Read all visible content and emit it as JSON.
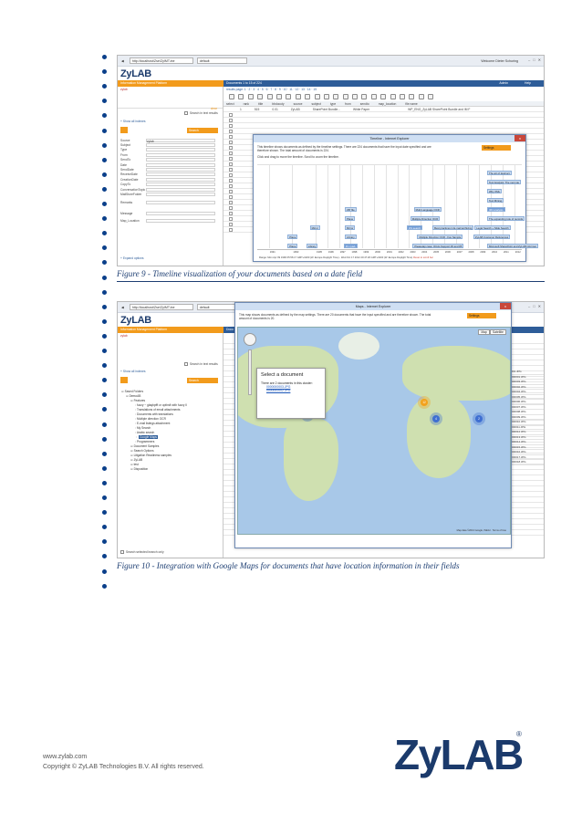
{
  "figure9": {
    "caption": "Figure 9 - Timeline visualization of your documents based on a date field",
    "browser": {
      "url": "http://localhost/Zse/ZyIMT.ine",
      "tab": "default",
      "welcome": "Welcome Dieter Schuring"
    },
    "logo_text": "ZyLAB",
    "nav": {
      "left": "Information Management Platform",
      "right": "Documents 1 to 15 of 224",
      "admin": "Admin",
      "help": "Help"
    },
    "results_page": "results page: 1 · 2 · 3 · 4 · 5 · 6 · 7 · 8 · 9 · 10 · 11 · 12 · 13 · 14 · 15",
    "columns": [
      "select",
      "rank",
      "title",
      "bbdocuty",
      "source",
      "subject",
      "type",
      "from",
      "sendto",
      "map_location",
      "file name"
    ],
    "first_row": [
      "1",
      "515",
      "0.01",
      "ZyLAB",
      "SharePoint Bundle...",
      "White Paper",
      "",
      "",
      "WP_ENG_ZyLAB SharePoint Bundle and IM F"
    ],
    "show_all_indexes": "+ Show all indexes",
    "search_in_text_results": "Search in text results",
    "search_label": "Search",
    "clear_label": "clear",
    "query": "zylab",
    "fields": [
      "Source",
      "Subject",
      "Type",
      "From",
      "SendTo",
      "Date",
      "SendDate",
      "ReceiveDate",
      "CreationDate",
      "CopyTo",
      "ConversationTopic",
      "MailStoreFolder",
      "Remarks",
      "Message",
      "Map_Location"
    ],
    "field_values": {
      "Source": "zylab"
    },
    "expand_all": "+ Expand options",
    "dialog": {
      "title": "Timeline - Internet Explorer",
      "close": "x",
      "description": "This timeline shows documents as defined by the timeline settings. There are 224 documents that have the input date specified and are therefore shown. The total amount of documents is 224.",
      "instruction": "Click and drag to move the timeline. Scroll to zoom the timeline.",
      "settings": "Settings",
      "events": [
        {
          "label": "The art of destruct",
          "year": 2011.6,
          "row": 0
        },
        {
          "label": "Text Analysis: The next ste",
          "year": 2010.6,
          "row": 1
        },
        {
          "label": "Why XML",
          "year": 2011.0,
          "row": 2
        },
        {
          "label": "Text Mining",
          "year": 2010.9,
          "row": 3
        },
        {
          "label": "ZIP file",
          "year": 1997.5,
          "row": 4
        },
        {
          "label": "Multi Language OCR",
          "year": 2003.4,
          "row": 4
        },
        {
          "label": "IM4 analysis",
          "year": 2010.1,
          "row": 4,
          "sel": true
        },
        {
          "label": "IM4 analysis",
          "year": 2011.5,
          "row": 4,
          "sel": true
        },
        {
          "label": "The expanding role of records",
          "year": 2010.7,
          "row": 5
        },
        {
          "label": "Plane",
          "year": 1997.5,
          "row": 5
        },
        {
          "label": "Multiple Direction OCR",
          "year": 2003.1,
          "row": 5
        },
        {
          "label": "Mirror",
          "year": 1994.5,
          "row": 6
        },
        {
          "label": "Mirror",
          "year": 1997.5,
          "row": 6
        },
        {
          "label": "OS search",
          "year": 2002.8,
          "row": 6,
          "sel": true
        },
        {
          "label": "Best practices in E-mail archiving",
          "year": 2005.0,
          "row": 6
        },
        {
          "label": "Legal Search + Slide Search",
          "year": 2008.6,
          "row": 6
        },
        {
          "label": "Plane",
          "year": 1992.6,
          "row": 7
        },
        {
          "label": "Library",
          "year": 1997.5,
          "row": 7
        },
        {
          "label": "Multiple Direction OCR - Fax Sample",
          "year": 2003.7,
          "row": 7
        },
        {
          "label": "ZyLAB Customer References",
          "year": 2008.5,
          "row": 7
        },
        {
          "label": "Plane",
          "year": 1992.6,
          "row": 8
        },
        {
          "label": "Library",
          "year": 1994.2,
          "row": 8
        },
        {
          "label": "IIS zylab",
          "year": 1997.4,
          "row": 8,
          "sel": true
        },
        {
          "label": "Pleasetap case: OCAs Support #3 and #5",
          "year": 2003.3,
          "row": 8
        },
        {
          "label": "Microsoft SharePoint and ZyLAB Informat",
          "year": 2009.7,
          "row": 8
        }
      ],
      "years": [
        "1991",
        "1993",
        "1995",
        "1996",
        "1997",
        "1998",
        "1999",
        "2000",
        "2001",
        "2002",
        "2003",
        "2004",
        "2005",
        "2006",
        "2007",
        "2008",
        "2009",
        "2010",
        "2011",
        "2012"
      ],
      "range_text": "Range: Mon Apr 09 1990 05:56:17 GMT+0200 (W. Europe Daylight Time) - Wed Oct 17 2012 20:47:20 GMT+0200 (W. Europe Daylight Time)",
      "reset": "Reset to scroll bar"
    }
  },
  "figure10": {
    "caption": "Figure 10 - Integration with Google Maps for documents that have location information in their fields",
    "browser": {
      "url": "http://localhost/Zse/ZyIMT.ine",
      "tab": "default"
    },
    "logo_text": "ZyLAB",
    "nav": {
      "left": "Information Management Platform",
      "right": "Docu"
    },
    "query": "zylab",
    "search_label": "Search",
    "search_in_text_results": "Search in text results",
    "show_all_indexes": "+ Show all indexes",
    "tree": [
      {
        "label": "Saved Folders",
        "indent": 0
      },
      {
        "label": "DemoAB",
        "indent": 1
      },
      {
        "label": "Features",
        "indent": 2
      },
      {
        "label": "fuzzy ~ glaqbpfft or opthsft with fuzzy II",
        "indent": 3
      },
      {
        "label": "Translations of email attachments",
        "indent": 3
      },
      {
        "label": "Documents with translations",
        "indent": 3
      },
      {
        "label": "Multiple direction OCR",
        "indent": 3
      },
      {
        "label": "E-mail listings attachment",
        "indent": 3
      },
      {
        "label": "My Search",
        "indent": 3
      },
      {
        "label": "Arabic search",
        "indent": 3
      },
      {
        "label": "Google Maps",
        "indent": 3,
        "sel": true
      },
      {
        "label": "Programmers",
        "indent": 3
      },
      {
        "label": "Document Samples",
        "indent": 2
      },
      {
        "label": "Search Options",
        "indent": 2
      },
      {
        "label": "Litigation Readiness samples",
        "indent": 2
      },
      {
        "label": "ZyLAB",
        "indent": 2
      },
      {
        "label": "test",
        "indent": 2
      },
      {
        "label": "Disposition",
        "indent": 2
      }
    ],
    "bottom_check": "Search selected branch only",
    "maps_dialog": {
      "title": "Maps - Internet Explorer",
      "description": "This map shows documents as defined by the map settings. There are 20 documents that have the input specified and are therefore shown. The total amount of documents is 20.",
      "settings": "Settings",
      "map_type": [
        "Map",
        "Satellite"
      ],
      "popup_title": "Select a document",
      "popup_text": "There are 2 documents in this cluster:",
      "popup_links": [
        "0000000003.JPG",
        "0000000002.JPG"
      ],
      "clusters": [
        "4",
        "12",
        "4",
        "2",
        "4"
      ],
      "attribution": "Map data ©2013 Google, INEGI · Terms of Use"
    },
    "files": [
      "0000001.JPG",
      "0000000001.JPG",
      "0000000003.JPG",
      "0000000002.JPG",
      "0000000004.JPG",
      "0000000005.JPG",
      "0000000006.JPG",
      "0000000007.JPG",
      "0000000008.JPG",
      "0000000009.JPG",
      "0000000010.JPG",
      "0000000011.JPG",
      "0000000012.JPG",
      "0000000013.JPG",
      "0000000014.JPG",
      "0000000015.JPG",
      "0000000016.JPG",
      "0000000017.JPG",
      "0000000018.JPG"
    ]
  },
  "footer": {
    "website": "www.zylab.com",
    "copyright": "Copyright ©   ZyLAB Technologies B.V. All rights reserved.",
    "logo": "ZyLAB",
    "registered": "®"
  },
  "colors": {
    "accent_orange": "#f29b1c",
    "nav_blue": "#2e5d99",
    "brand_navy": "#1b3a6b",
    "bullet_blue": "#0a3f8a",
    "caption_blue": "#1d3e72"
  }
}
